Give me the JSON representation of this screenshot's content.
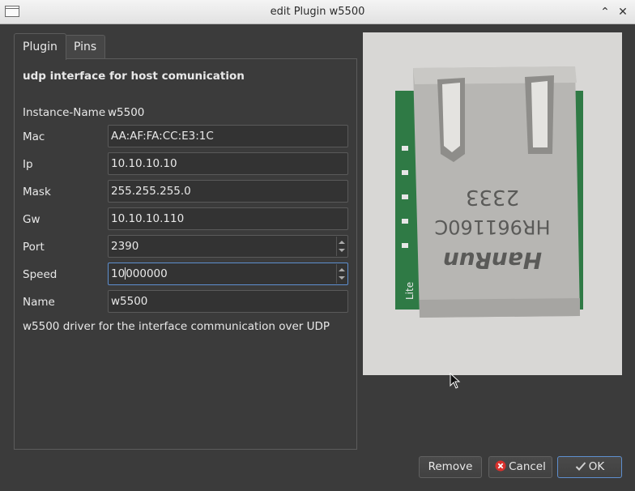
{
  "window": {
    "title": "edit Plugin w5500"
  },
  "tabs": [
    {
      "label": "Plugin"
    },
    {
      "label": "Pins"
    }
  ],
  "plugin": {
    "heading": "udp interface for host comunication",
    "instance_label": "Instance-Name",
    "instance_value": "w5500",
    "fields": {
      "mac": {
        "label": "Mac",
        "value": "AA:AF:FA:CC:E3:1C"
      },
      "ip": {
        "label": "Ip",
        "value": "10.10.10.10"
      },
      "mask": {
        "label": "Mask",
        "value": "255.255.255.0"
      },
      "gw": {
        "label": "Gw",
        "value": "10.10.10.110"
      },
      "port": {
        "label": "Port",
        "value": "2390"
      },
      "speed": {
        "label": "Speed",
        "value_before_caret": "10",
        "value_after_caret": "000000"
      },
      "name": {
        "label": "Name",
        "value": "w5500"
      }
    },
    "description": "w5500 driver for the interface communication over UDP"
  },
  "photo": {
    "marking_top": "2333",
    "marking_part": "HR961160C",
    "marking_brand": "HanRun",
    "marking_side": "Lite"
  },
  "buttons": {
    "remove": "Remove",
    "cancel": "Cancel",
    "ok": "OK"
  },
  "colors": {
    "background": "#3b3b3b",
    "focus": "#5e8fcf"
  }
}
